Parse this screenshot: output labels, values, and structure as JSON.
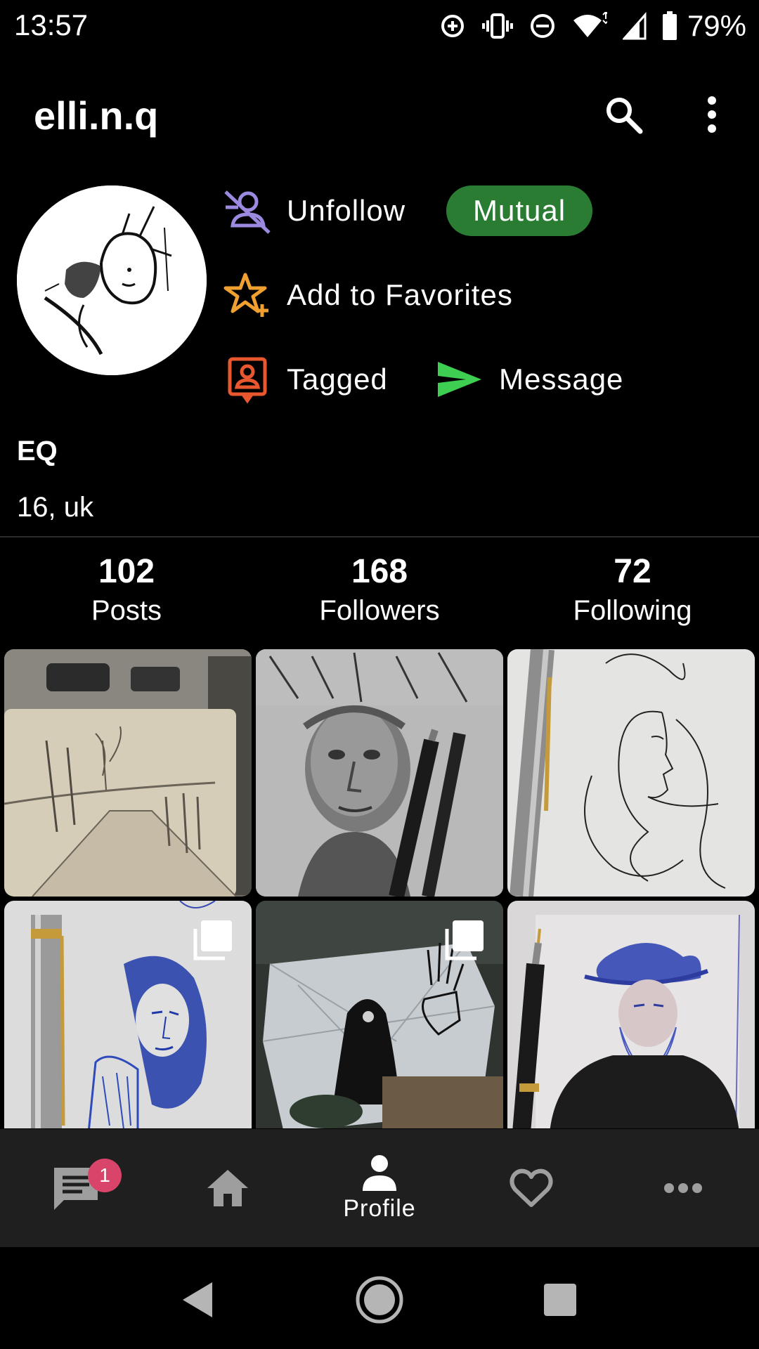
{
  "status_bar": {
    "time": "13:57",
    "battery_percent": "79%",
    "icons": [
      "data-saver-icon",
      "vibrate-icon",
      "do-not-disturb-icon",
      "wifi-icon",
      "signal-icon",
      "battery-icon"
    ]
  },
  "app_bar": {
    "username": "elli.n.q",
    "actions": [
      "search-icon",
      "more-vert-icon"
    ]
  },
  "profile": {
    "display_name": "EQ",
    "bio": "16, uk",
    "mutual_badge": "Mutual",
    "actions": {
      "unfollow": "Unfollow",
      "favorites": "Add to Favorites",
      "tagged": "Tagged",
      "message": "Message"
    }
  },
  "stats": [
    {
      "count": "102",
      "label": "Posts"
    },
    {
      "count": "168",
      "label": "Followers"
    },
    {
      "count": "72",
      "label": "Following"
    }
  ],
  "posts": [
    {
      "subject": "pencil sketch of a country road on a notebook over a comic page",
      "multi": false
    },
    {
      "subject": "graphite portrait of an old man with pencils over a comic page",
      "multi": false
    },
    {
      "subject": "ink line drawing of a woman in profile with a fountain pen",
      "multi": false
    },
    {
      "subject": "blue ballpoint drawing of a woman with a pen",
      "multi": true
    },
    {
      "subject": "ink drawing on crumpled paper of a hooded figure and a hand",
      "multi": true
    },
    {
      "subject": "blue ink portrait of a bearded man in a hat with a fountain pen",
      "multi": false
    }
  ],
  "bottom_nav": {
    "items": [
      {
        "name": "messages",
        "icon": "chat-icon",
        "badge": "1"
      },
      {
        "name": "home",
        "icon": "home-icon"
      },
      {
        "name": "profile",
        "icon": "person-icon",
        "label": "Profile",
        "active": true
      },
      {
        "name": "activity",
        "icon": "heart-icon"
      },
      {
        "name": "more",
        "icon": "more-horiz-icon"
      }
    ]
  },
  "colors": {
    "background": "#000000",
    "mutual_green": "#2a7c33",
    "unfollow_purple": "#9b8ae0",
    "favorites_orange": "#f0a030",
    "tagged_red": "#e8572e",
    "message_green": "#3ecf52",
    "badge_pink": "#d9456a",
    "nav_background": "#1f1f1f"
  }
}
